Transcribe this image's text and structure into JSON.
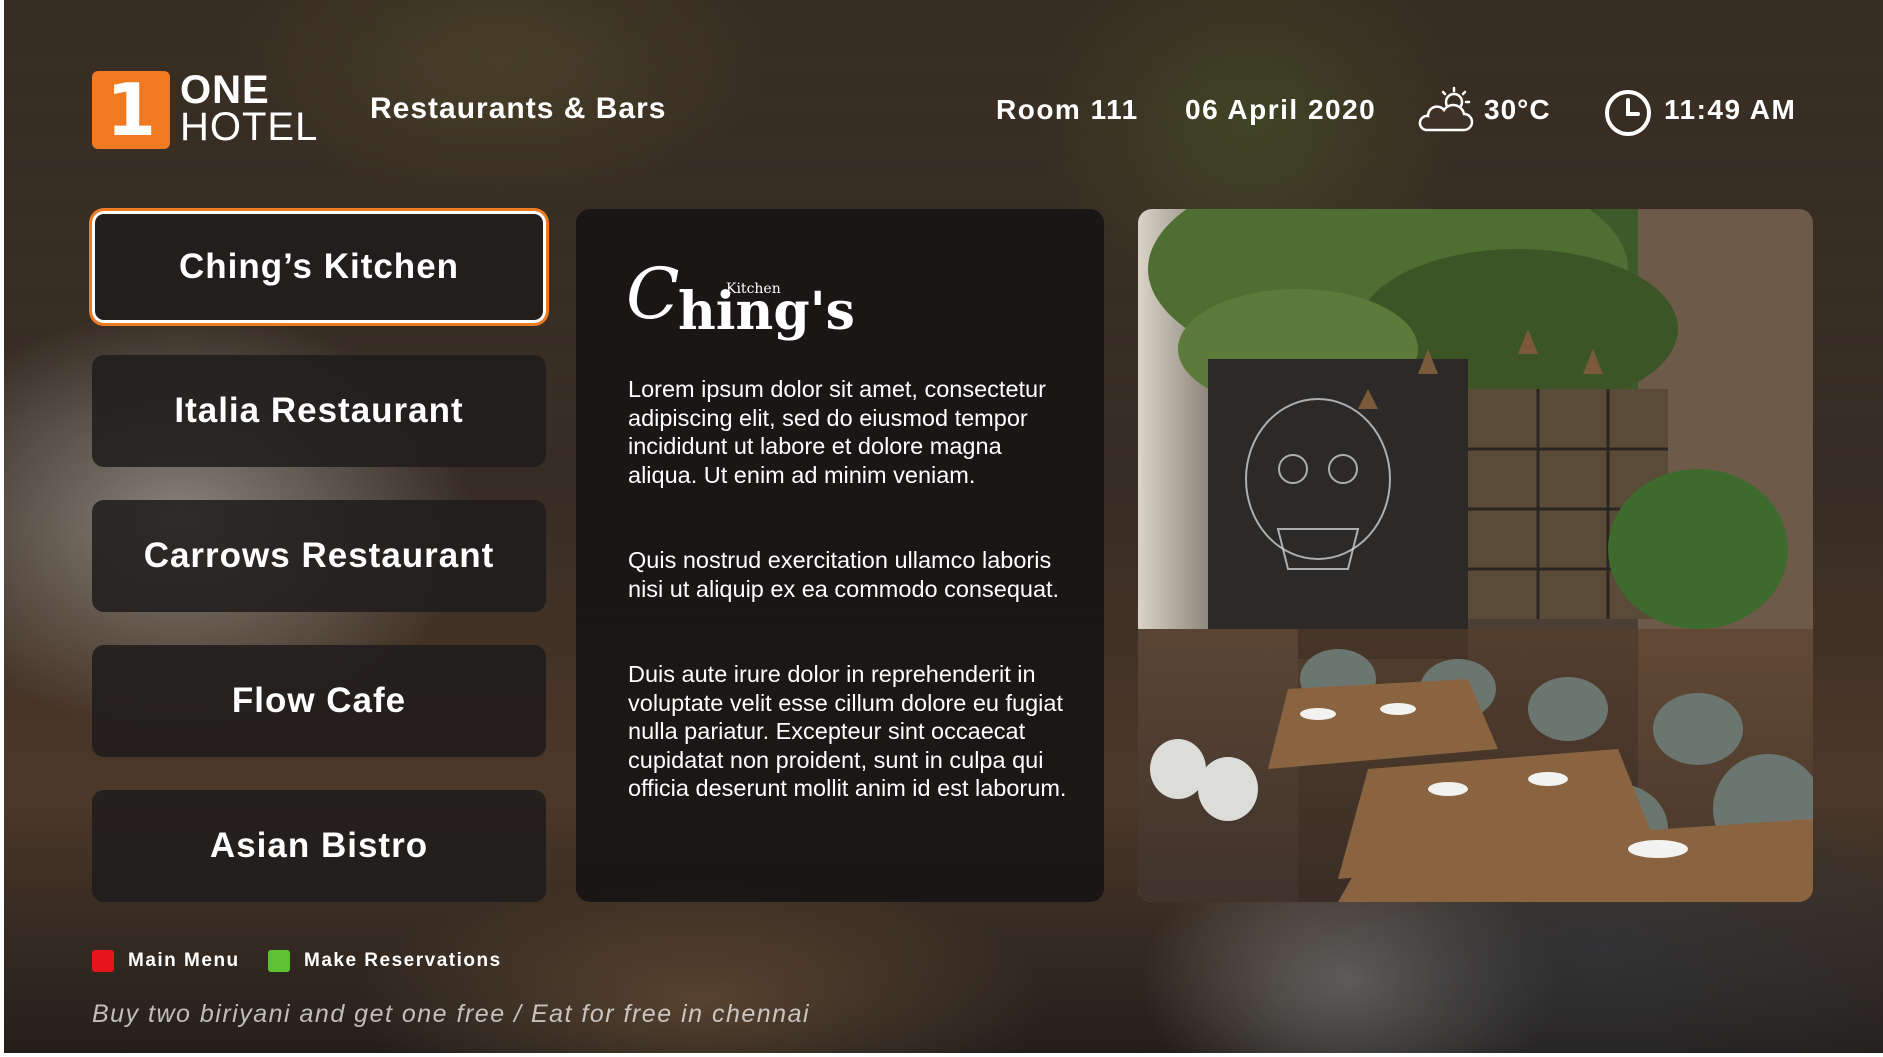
{
  "header": {
    "logo_mark": "1",
    "logo_line1": "ONE",
    "logo_line2": "HOTEL",
    "section_title": "Restaurants & Bars",
    "room": "Room 111",
    "date": "06 April 2020",
    "weather_icon": "partly-cloudy-icon",
    "temperature": "30°C",
    "clock_icon": "clock-icon",
    "time": "11:49 AM"
  },
  "menu": {
    "items": [
      {
        "label": "Ching’s Kitchen",
        "active": true
      },
      {
        "label": "Italia Restaurant",
        "active": false
      },
      {
        "label": "Carrows Restaurant",
        "active": false
      },
      {
        "label": "Flow Cafe",
        "active": false
      },
      {
        "label": "Asian Bistro",
        "active": false
      }
    ]
  },
  "detail": {
    "brand_logo": {
      "initial": "C",
      "rest": "hing's",
      "small": "Kitchen"
    },
    "paragraphs": [
      "Lorem ipsum dolor sit amet, consectetur adipiscing elit, sed do eiusmod tempor incididunt ut labore et dolore magna aliqua. Ut enim ad minim veniam.",
      "Quis nostrud exercitation ullamco laboris nisi ut aliquip ex ea commodo consequat.",
      "Duis aute irure dolor in reprehenderit in voluptate velit esse cillum dolore eu fugiat nulla pariatur. Excepteur sint occaecat cupidatat non proident, sunt in culpa qui officia deserunt mollit anim id est laborum."
    ]
  },
  "footer": {
    "keys": [
      {
        "label": "Main Menu",
        "color": "#e8141c"
      },
      {
        "label": "Make Reservations",
        "color": "#5cc234"
      }
    ],
    "ticker": "Buy two biriyani and get one free /  Eat for free in chennai"
  },
  "colors": {
    "brand_orange": "#f07a22"
  }
}
